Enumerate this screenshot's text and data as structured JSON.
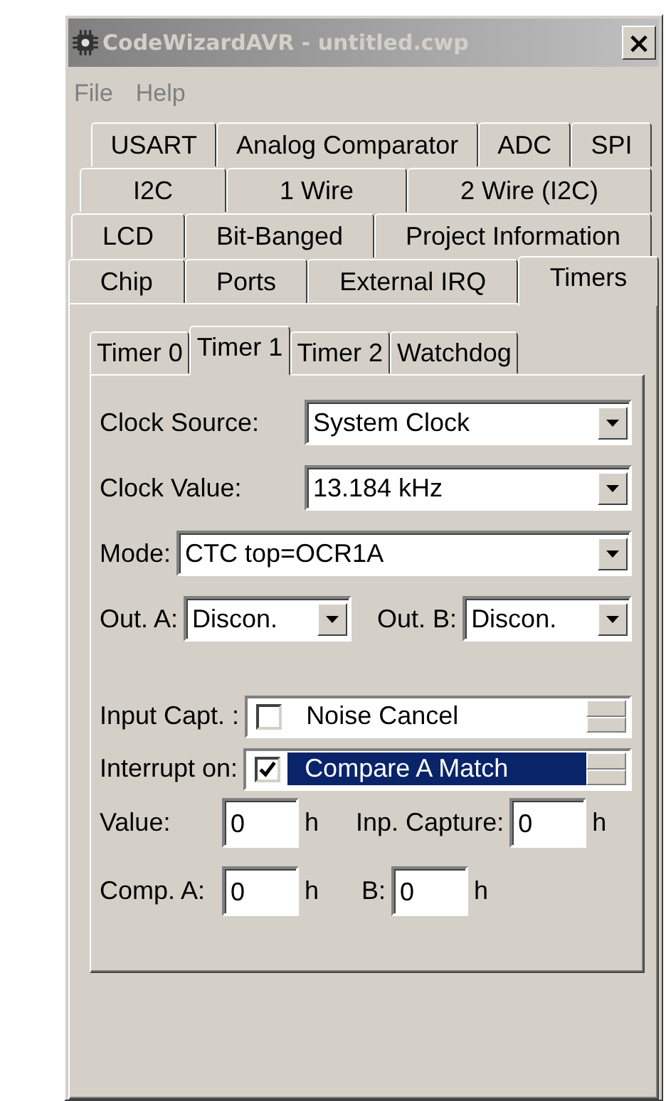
{
  "window": {
    "title": "CodeWizardAVR - untitled.cwp",
    "close": "×"
  },
  "menu": [
    {
      "label": "File",
      "disabled": true
    },
    {
      "label": "Help",
      "disabled": true
    }
  ],
  "tab_rows": [
    [
      {
        "label": "USART",
        "selected": false
      },
      {
        "label": "Analog Comparator",
        "selected": false
      },
      {
        "label": "ADC",
        "selected": false
      },
      {
        "label": "SPI",
        "selected": false
      }
    ],
    [
      {
        "label": "I2C",
        "selected": false
      },
      {
        "label": "1 Wire",
        "selected": false
      },
      {
        "label": "2 Wire (I2C)",
        "selected": false
      }
    ],
    [
      {
        "label": "LCD",
        "selected": false
      },
      {
        "label": "Bit-Banged",
        "selected": false
      },
      {
        "label": "Project Information",
        "selected": false
      }
    ],
    [
      {
        "label": "Chip",
        "selected": false
      },
      {
        "label": "Ports",
        "selected": false
      },
      {
        "label": "External IRQ",
        "selected": false
      },
      {
        "label": "Timers",
        "selected": true
      }
    ]
  ],
  "inner_tabs": [
    {
      "label": "Timer 0",
      "selected": false
    },
    {
      "label": "Timer 1",
      "selected": true
    },
    {
      "label": "Timer 2",
      "selected": false
    },
    {
      "label": "Watchdog",
      "selected": false
    }
  ],
  "clock_source": {
    "label": "Clock Source:",
    "value": "System Clock"
  },
  "clock_value": {
    "label": "Clock Value:",
    "value": "13.184 kHz"
  },
  "mode": {
    "label": "Mode:",
    "value": "CTC top=OCR1A"
  },
  "out_a": {
    "label": "Out. A:",
    "value": "Discon."
  },
  "out_b": {
    "label": "Out. B:",
    "value": "Discon."
  },
  "input_capt": {
    "label": "Input Capt. :",
    "option": "Noise Cancel",
    "checked": false,
    "selected": false
  },
  "interrupt_on": {
    "label": "Interrupt on:",
    "option": "Compare A Match",
    "checked": true,
    "selected": true
  },
  "value": {
    "label": "Value:",
    "value": "0",
    "unit": "h"
  },
  "inp_capture": {
    "label": "Inp. Capture:",
    "value": "0",
    "unit": "h"
  },
  "comp_a": {
    "label": "Comp. A:",
    "value": "0",
    "unit": "h"
  },
  "comp_b": {
    "label": "B:",
    "value": "0",
    "unit": "h"
  }
}
